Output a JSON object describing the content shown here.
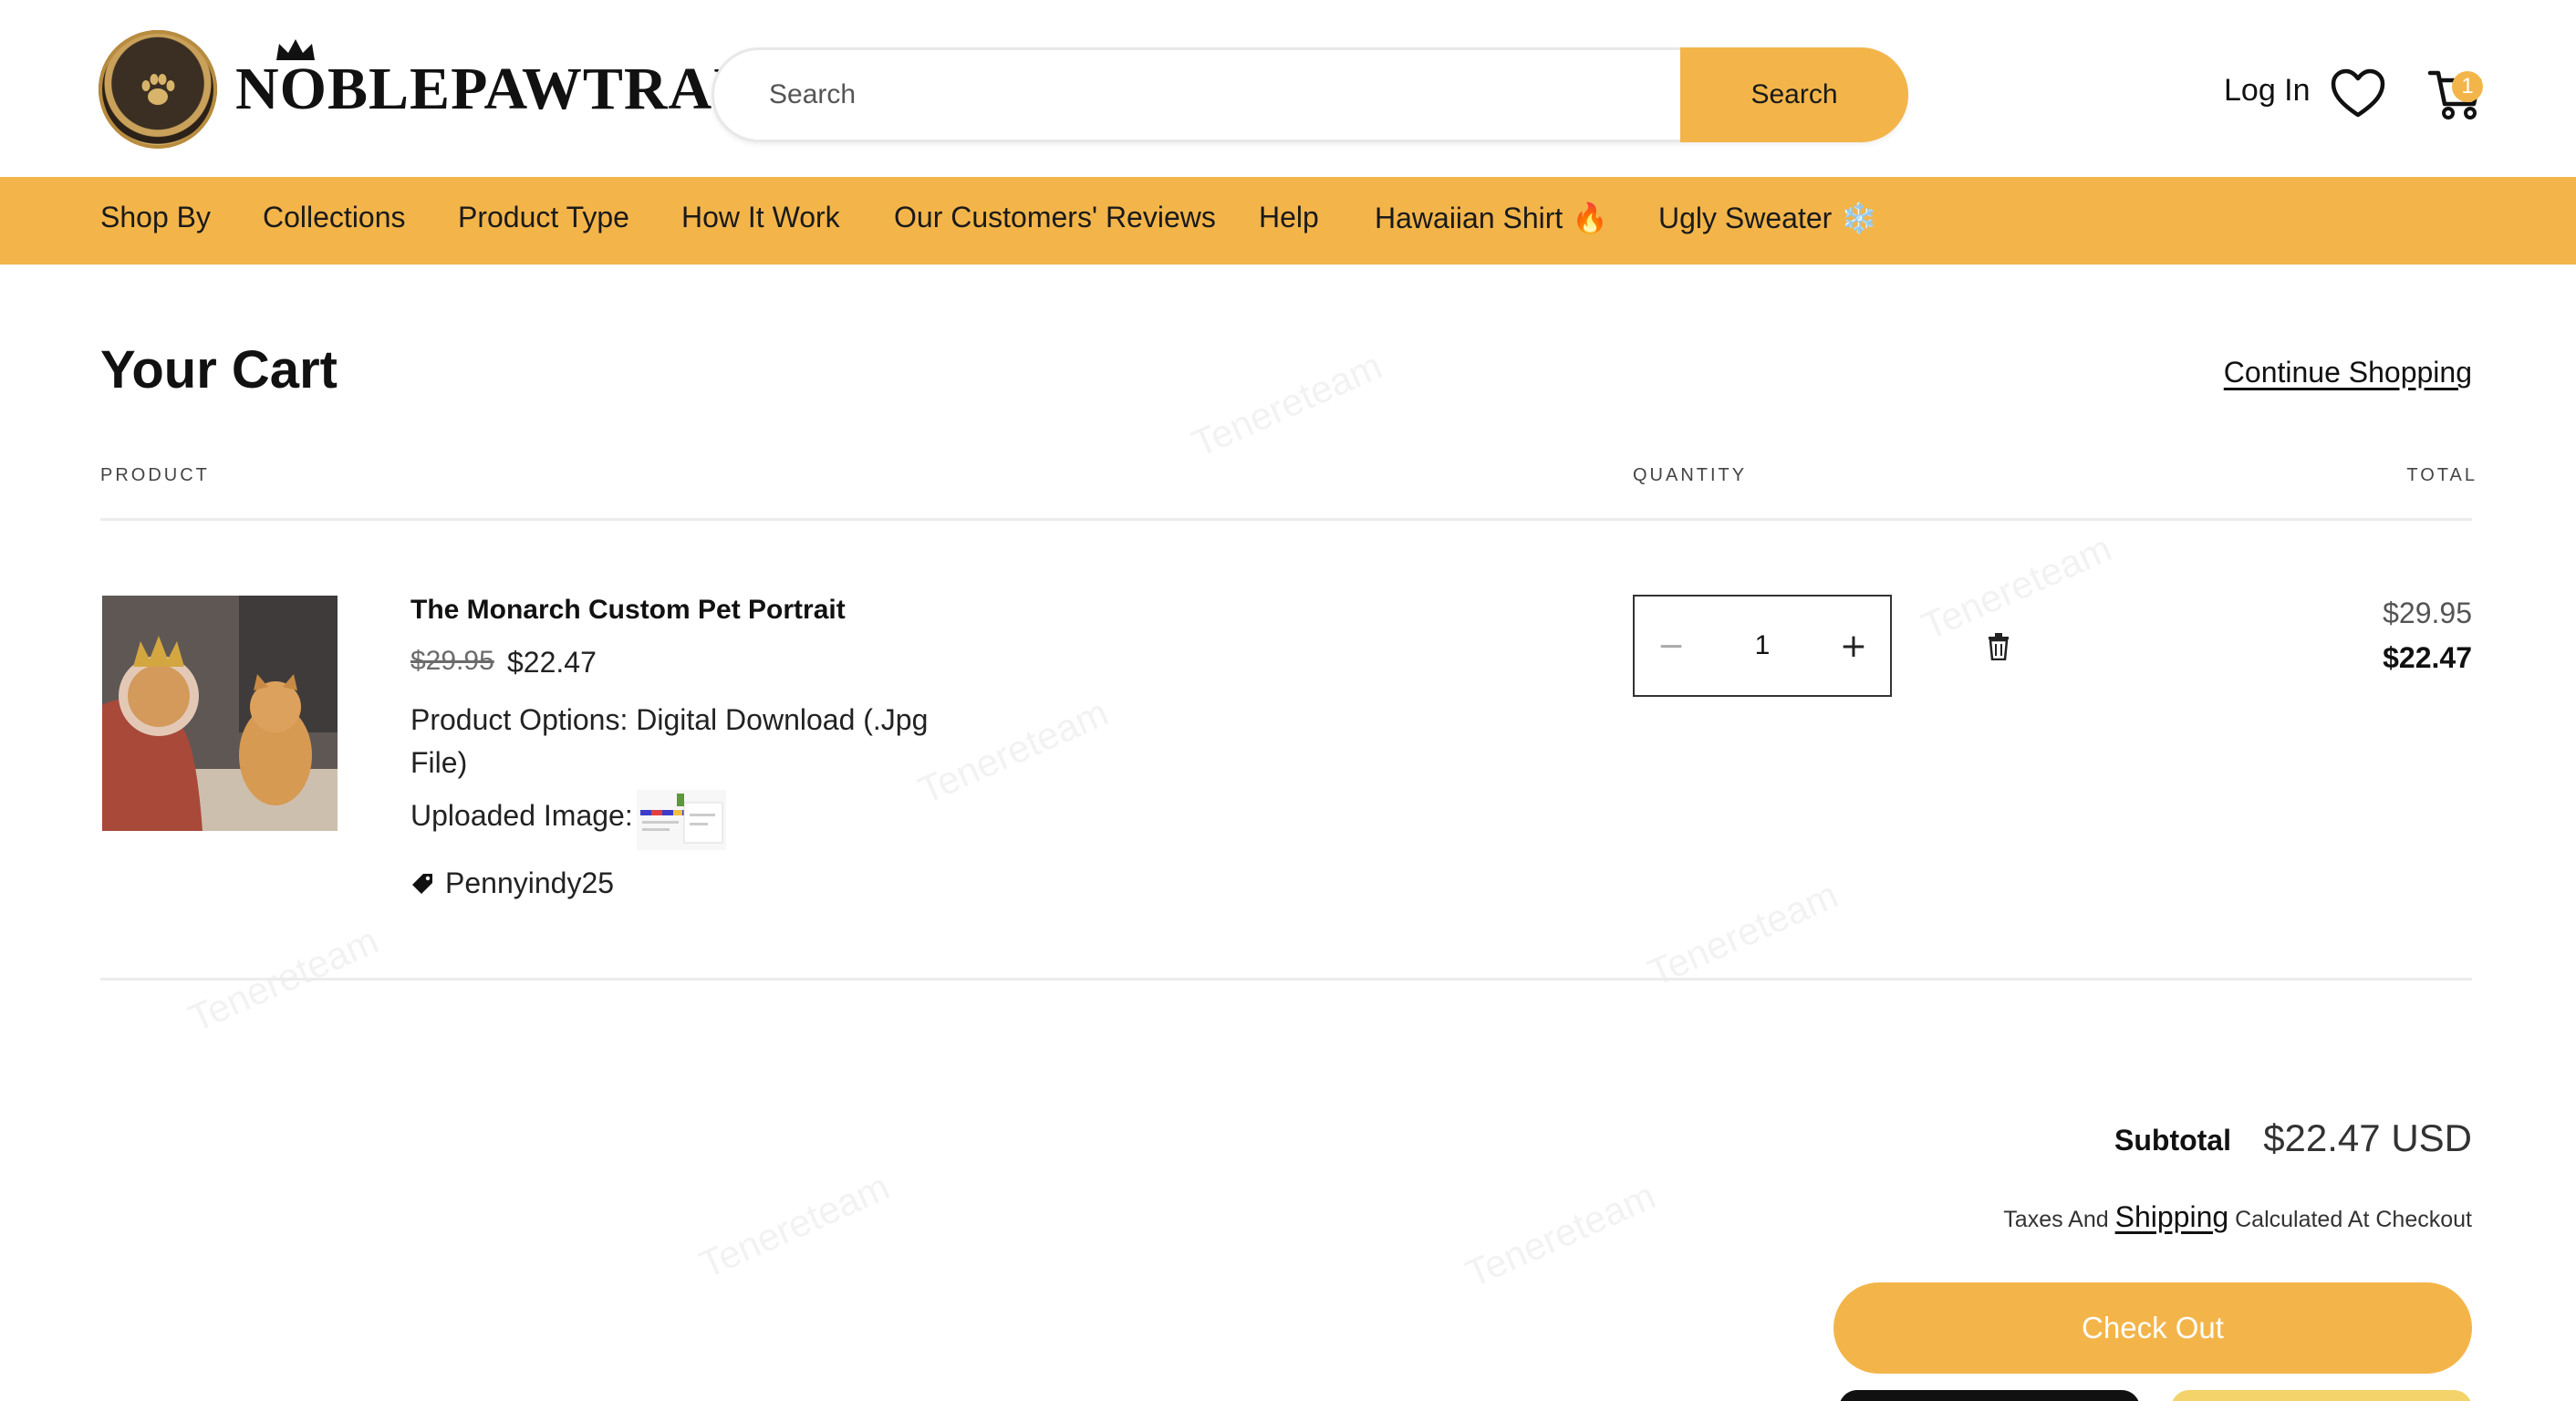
{
  "header": {
    "logo_text": "NOBLEPAWTRAIT",
    "search": {
      "placeholder": "Search",
      "button_label": "Search"
    },
    "login_label": "Log In",
    "cart_count": "1"
  },
  "nav": {
    "items": [
      {
        "label": "Shop By"
      },
      {
        "label": "Collections"
      },
      {
        "label": "Product Type"
      },
      {
        "label": "How It Work"
      },
      {
        "label": "Our Customers' Reviews"
      },
      {
        "label": "Help"
      },
      {
        "label": "Hawaiian Shirt",
        "emoji": "🔥"
      },
      {
        "label": "Ugly Sweater",
        "emoji": "❄️"
      }
    ]
  },
  "cart": {
    "title": "Your Cart",
    "continue_label": "Continue Shopping",
    "columns": {
      "product": "PRODUCT",
      "quantity": "QUANTITY",
      "total": "TOTAL"
    },
    "item": {
      "name": "The Monarch Custom Pet Portrait",
      "price_original": "$29.95",
      "price_sale": "$22.47",
      "options": "Product Options: Digital Download (.Jpg File)",
      "uploaded_label": "Uploaded Image:",
      "discount_code": "Pennyindy25",
      "quantity": "1",
      "total_original": "$29.95",
      "total_sale": "$22.47"
    },
    "subtotal_label": "Subtotal",
    "subtotal_value": "$22.47 USD",
    "tax_prefix": "Taxes And",
    "tax_link": "Shipping",
    "tax_suffix": "Calculated At Checkout",
    "checkout_label": "Check Out"
  },
  "watermark": "Tenereteam",
  "colors": {
    "accent": "#f3b54a",
    "text": "#111111",
    "divider": "#ececec"
  }
}
